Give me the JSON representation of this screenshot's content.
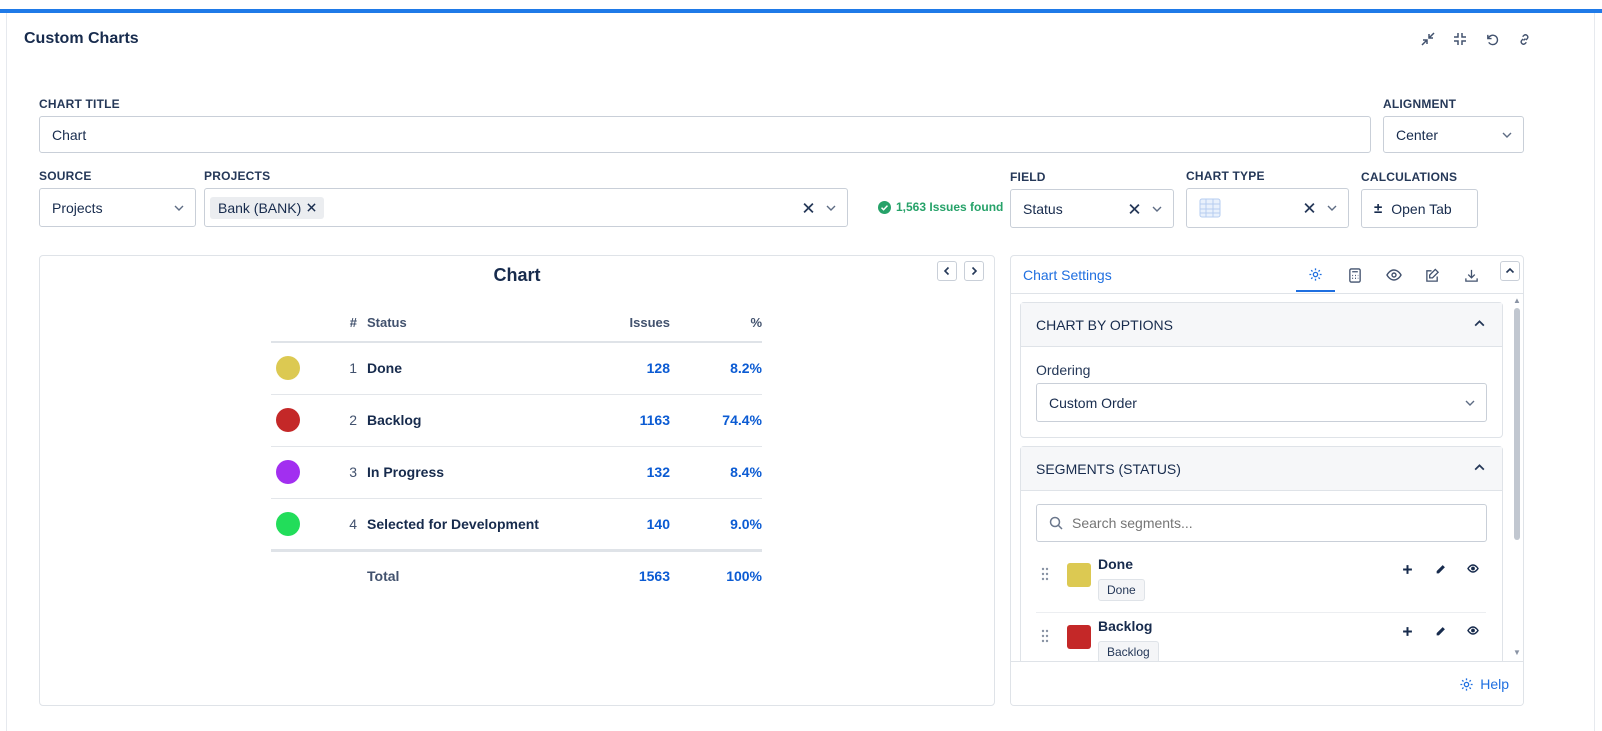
{
  "header": {
    "title": "Custom Charts"
  },
  "form": {
    "chart_title_label": "CHART TITLE",
    "chart_title_value": "Chart",
    "alignment_label": "ALIGNMENT",
    "alignment_value": "Center",
    "source_label": "SOURCE",
    "source_value": "Projects",
    "projects_label": "PROJECTS",
    "project_tag": "Bank (BANK)",
    "issues_found": "1,563 Issues found",
    "field_label": "FIELD",
    "field_value": "Status",
    "chart_type_label": "CHART TYPE",
    "calculations_label": "CALCULATIONS",
    "calculations_button": "Open Tab"
  },
  "chart": {
    "title": "Chart",
    "columns": {
      "index": "#",
      "status": "Status",
      "issues": "Issues",
      "percent": "%"
    },
    "rows": [
      {
        "index": "1",
        "status": "Done",
        "issues": "128",
        "percent": "8.2%",
        "color": "#dcc952"
      },
      {
        "index": "2",
        "status": "Backlog",
        "issues": "1163",
        "percent": "74.4%",
        "color": "#c42828"
      },
      {
        "index": "3",
        "status": "In Progress",
        "issues": "132",
        "percent": "8.4%",
        "color": "#a22ff0"
      },
      {
        "index": "4",
        "status": "Selected for Development",
        "issues": "140",
        "percent": "9.0%",
        "color": "#22dd5a"
      }
    ],
    "total": {
      "label": "Total",
      "issues": "1563",
      "percent": "100%"
    }
  },
  "settings": {
    "title": "Chart Settings",
    "tabs": [
      "gear-icon",
      "calculator-icon",
      "eye-icon",
      "edit-icon",
      "download-icon"
    ],
    "chart_by": {
      "heading": "CHART BY OPTIONS",
      "ordering_label": "Ordering",
      "ordering_value": "Custom Order"
    },
    "segments": {
      "heading": "SEGMENTS (STATUS)",
      "search_placeholder": "Search segments...",
      "items": [
        {
          "name": "Done",
          "badge": "Done",
          "color": "#dcc952"
        },
        {
          "name": "Backlog",
          "badge": "Backlog",
          "color": "#c42828"
        }
      ]
    },
    "help": "Help"
  }
}
